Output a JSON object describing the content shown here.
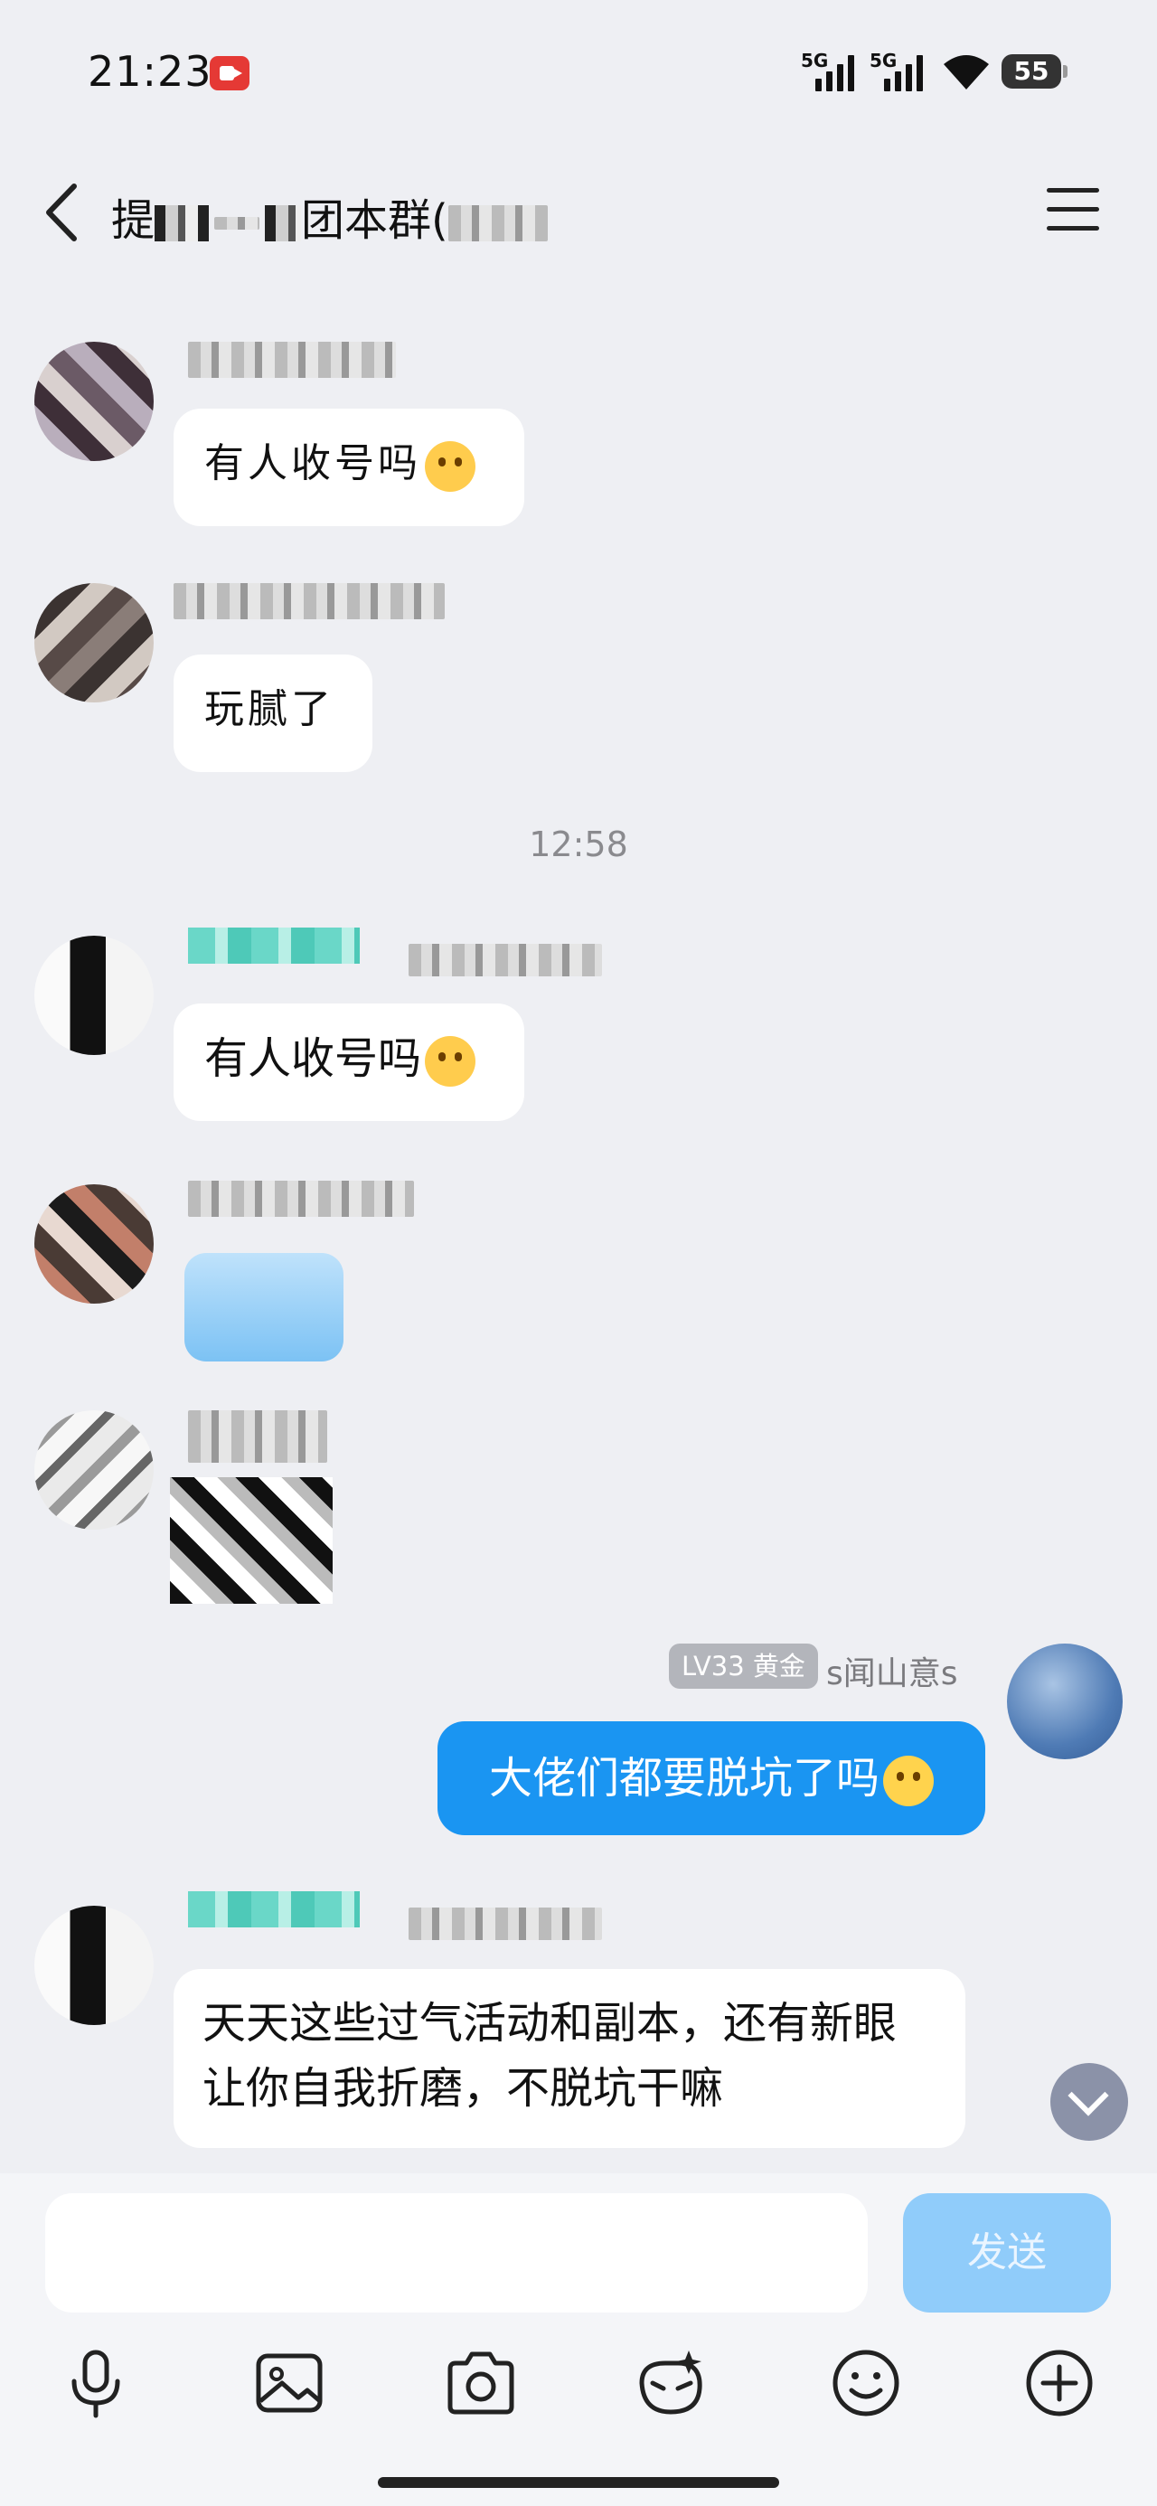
{
  "status": {
    "time": "21:23",
    "network1": "5G",
    "network2": "5G",
    "battery": "55"
  },
  "header": {
    "title_prefix": "提",
    "title_middle": "团本群(",
    "back_label": "back"
  },
  "messages": [
    {
      "text": "有人收号吗"
    },
    {
      "text": "玩腻了"
    },
    {
      "text": "有人收号吗"
    },
    {
      "text": "大佬们都要脱坑了吗"
    },
    {
      "text": "天天这些过气活动和副本，还有新眼让你自我折磨，不脱坑干嘛"
    }
  ],
  "separator_time": "12:58",
  "my": {
    "level_tag": "LV33 黄金",
    "name": "s闻山意s"
  },
  "input": {
    "placeholder": "",
    "send_label": "发送"
  },
  "colors": {
    "accent": "#1a95f2",
    "send_disabled": "#90ccfa",
    "background": "#eeeff3"
  }
}
